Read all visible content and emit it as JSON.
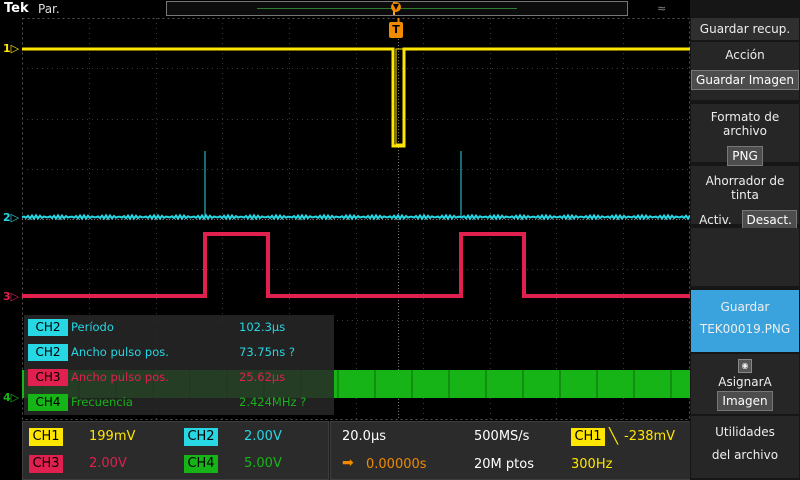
{
  "header": {
    "brand": "Tek",
    "mode": "Par."
  },
  "trigger": {
    "label": "T"
  },
  "channel_markers": [
    "1",
    "2",
    "3",
    "4"
  ],
  "colors": {
    "ch1": "#ffe600",
    "ch2": "#27d7e3",
    "ch3": "#e0204e",
    "ch4": "#17b417",
    "trigger": "#f08a00",
    "selected": "#3aa3dd"
  },
  "measurements": [
    {
      "channel": "CH2",
      "name": "Período",
      "value": "102.3µs"
    },
    {
      "channel": "CH2",
      "name": "Ancho pulso pos.",
      "value": "73.75ns  ?"
    },
    {
      "channel": "CH3",
      "name": "Ancho pulso pos.",
      "value": "25.62µs"
    },
    {
      "channel": "CH4",
      "name": "Frecuencia",
      "value": "2.424MHz  ?"
    }
  ],
  "vertical": {
    "ch1": {
      "label": "CH1",
      "scale": "199mV"
    },
    "ch2": {
      "label": "CH2",
      "scale": "2.00V"
    },
    "ch3": {
      "label": "CH3",
      "scale": "2.00V"
    },
    "ch4": {
      "label": "CH4",
      "scale": "5.00V"
    }
  },
  "horizontal": {
    "time_per_div": "20.0µs",
    "sample_rate": "500MS/s",
    "position": "0.00000s",
    "record_length": "20M ptos"
  },
  "trigger_info": {
    "channel": "CH1",
    "level": "-238mV",
    "frequency": "300Hz"
  },
  "sidebar": {
    "title": "Guardar recup.",
    "accion_label": "Acción",
    "accion_value": "Guardar Imagen",
    "formato_label": "Formato de archivo",
    "formato_value": "PNG",
    "ahorrador_label": "Ahorrador de tinta",
    "ahorrador_on": "Activ.",
    "ahorrador_off": "Desact.",
    "guardar_label": "Guardar",
    "guardar_file": "TEK00019.PNG",
    "asignar_label": "AsignarA",
    "asignar_value": "Imagen",
    "utilidades_line1": "Utilidades",
    "utilidades_line2": "del archivo"
  }
}
